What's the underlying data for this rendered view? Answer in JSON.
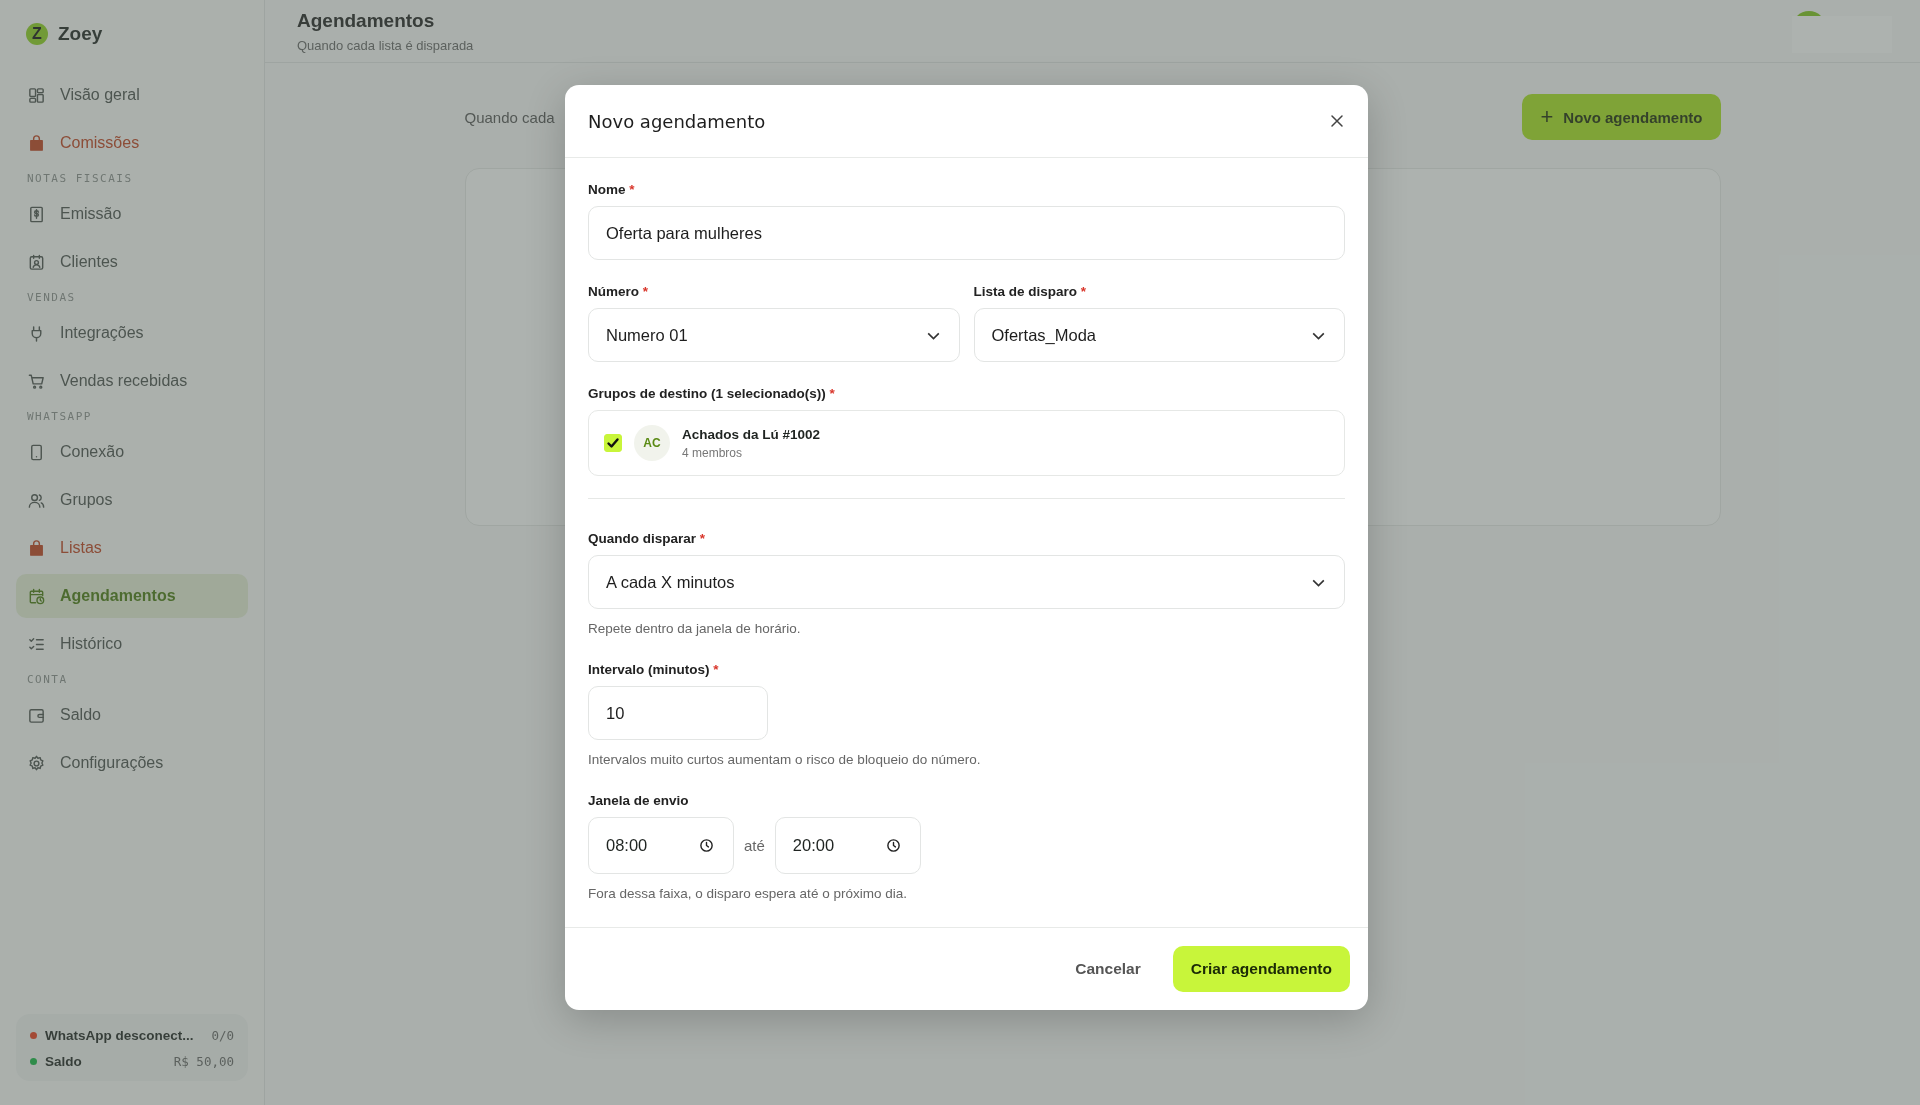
{
  "brand": {
    "logo": "Z",
    "name": "Zoey"
  },
  "sidebar": {
    "sections": [
      {
        "items": [
          {
            "label": "Visão geral",
            "accent": false,
            "selected": false
          },
          {
            "label": "Comissões",
            "accent": true,
            "selected": false
          }
        ]
      },
      {
        "heading": "NOTAS FISCAIS",
        "items": [
          {
            "label": "Emissão",
            "accent": false,
            "selected": false
          },
          {
            "label": "Clientes",
            "accent": false,
            "selected": false
          }
        ]
      },
      {
        "heading": "VENDAS",
        "items": [
          {
            "label": "Integrações",
            "accent": false,
            "selected": false
          },
          {
            "label": "Vendas recebidas",
            "accent": false,
            "selected": false
          }
        ]
      },
      {
        "heading": "WHATSAPP",
        "items": [
          {
            "label": "Conexão",
            "accent": false,
            "selected": false
          },
          {
            "label": "Grupos",
            "accent": false,
            "selected": false
          },
          {
            "label": "Listas",
            "accent": true,
            "selected": false
          },
          {
            "label": "Agendamentos",
            "accent": false,
            "selected": true
          },
          {
            "label": "Histórico",
            "accent": false,
            "selected": false
          }
        ]
      },
      {
        "heading": "CONTA",
        "items": [
          {
            "label": "Saldo",
            "accent": false,
            "selected": false
          },
          {
            "label": "Configurações",
            "accent": false,
            "selected": false
          }
        ]
      }
    ],
    "status": [
      {
        "label": "WhatsApp desconect...",
        "value": "0/0",
        "color": "#a34a36"
      },
      {
        "label": "Saldo",
        "value": "R$ 50,00",
        "color": "#2f8c4a"
      }
    ]
  },
  "header": {
    "title": "Agendamentos",
    "subtitle": "Quando cada lista é disparada"
  },
  "page": {
    "intro": "Quando cada",
    "new_button": {
      "icon": "+",
      "label": "Novo agendamento"
    }
  },
  "modal": {
    "title": "Novo agendamento",
    "nome": {
      "label": "Nome",
      "mark": "*",
      "value": "Oferta para mulheres"
    },
    "numero": {
      "label": "Número",
      "mark": "*",
      "value": "Numero 01"
    },
    "lista": {
      "label": "Lista de disparo",
      "mark": "*",
      "value": "Ofertas_Moda"
    },
    "grupos": {
      "label": "Grupos de destino (1 selecionado(s))",
      "mark": "*",
      "items": [
        {
          "initials": "AC",
          "name": "Achados da Lú #1002",
          "members": "4 membros",
          "checked": true
        }
      ]
    },
    "quando": {
      "label": "Quando disparar",
      "mark": "*",
      "value": "A cada X minutos",
      "hint": "Repete dentro da janela de horário."
    },
    "intervalo": {
      "label": "Intervalo (minutos)",
      "mark": "*",
      "value": "10",
      "hint": "Intervalos muito curtos aumentam o risco de bloqueio do número."
    },
    "janela": {
      "label": "Janela de envio",
      "start": "08:00",
      "separator": "até",
      "end": "20:00",
      "hint": "Fora dessa faixa, o disparo espera até o próximo dia."
    },
    "cancel": "Cancelar",
    "submit": "Criar agendamento"
  }
}
